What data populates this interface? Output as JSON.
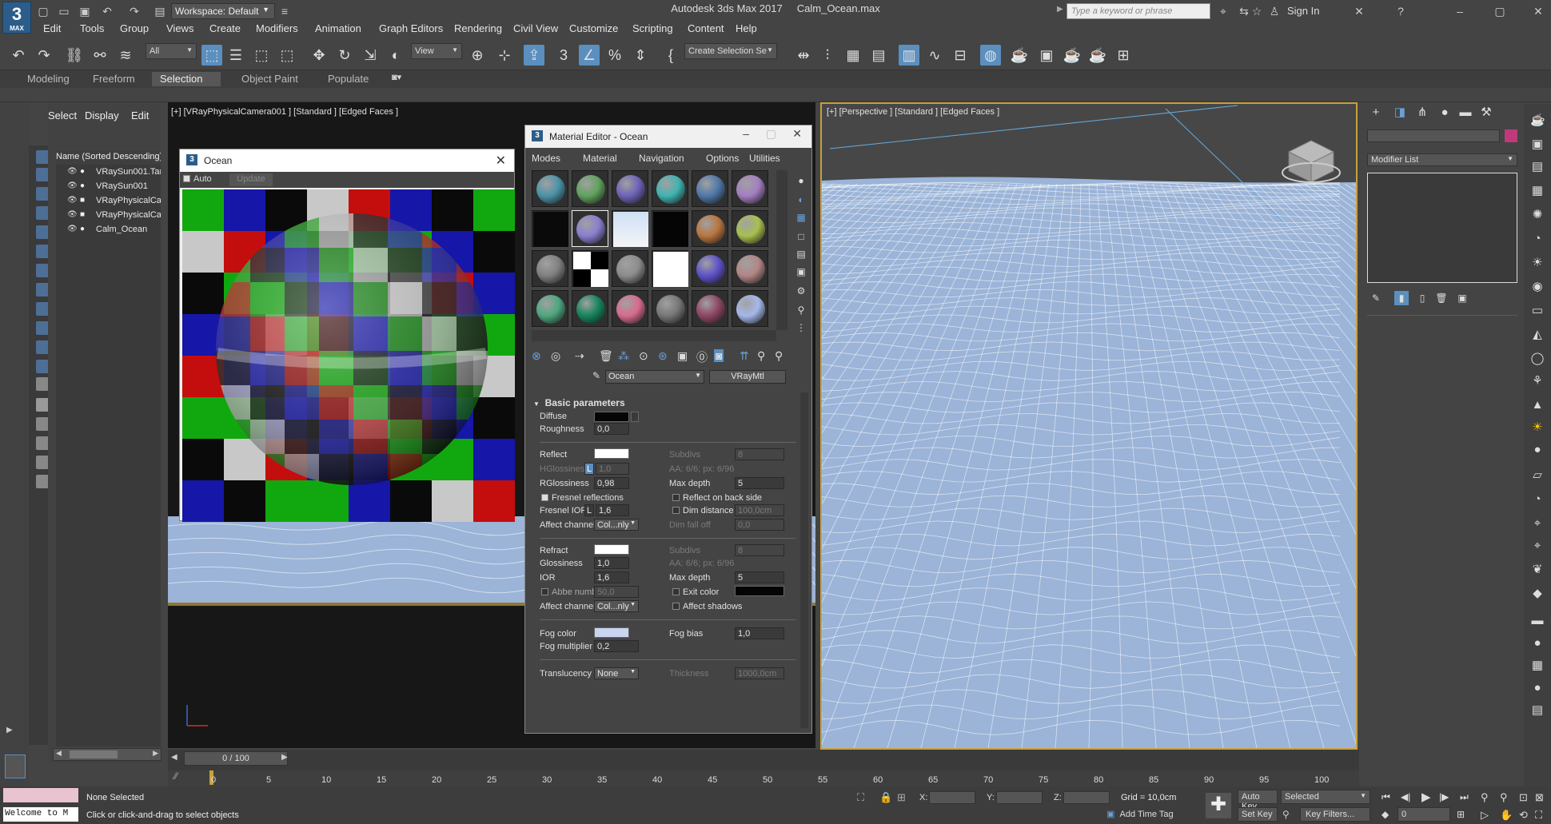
{
  "app": {
    "logo_text": "3",
    "logo_sub": "MAX",
    "title": "Autodesk 3ds Max 2017",
    "file": "Calm_Ocean.max",
    "workspace": "Workspace: Default",
    "search_placeholder": "Type a keyword or phrase",
    "sign_in": "Sign In"
  },
  "menus": [
    "Edit",
    "Tools",
    "Group",
    "Views",
    "Create",
    "Modifiers",
    "Animation",
    "Graph Editors",
    "Rendering",
    "Civil View",
    "Customize",
    "Scripting",
    "Content",
    "Help"
  ],
  "toolbar": {
    "filter": "All",
    "ref_coord": "View",
    "selection_set": "Create Selection Se"
  },
  "ribbon_tabs": [
    "Modeling",
    "Freeform",
    "Selection",
    "Object Paint",
    "Populate"
  ],
  "ribbon_active": "Selection",
  "scene_explorer": {
    "tabs": [
      "Select",
      "Display",
      "Edit"
    ],
    "header": "Name (Sorted Descending)",
    "items": [
      "VRaySun001.Tar",
      "VRaySun001",
      "VRayPhysicalCan",
      "VRayPhysicalCan",
      "Calm_Ocean"
    ]
  },
  "viewport_left": {
    "label": "[+] [VRayPhysicalCamera001 ] [Standard ] [Edged Faces ]"
  },
  "viewport_right": {
    "label": "[+] [Perspective ] [Standard ] [Edged Faces ]"
  },
  "ocean_window": {
    "title": "Ocean",
    "auto_label": "Auto",
    "update_label": "Update"
  },
  "material_editor": {
    "title": "Material Editor - Ocean",
    "menus": [
      "Modes",
      "Material",
      "Navigation",
      "Options",
      "Utilities"
    ],
    "material_name": "Ocean",
    "material_type": "VRayMtl",
    "rollout": "Basic parameters",
    "slot_colors": [
      "#4b93a8",
      "#5fa35d",
      "#6d63b8",
      "#3fb4b2",
      "#4f78a8",
      "#a47ec2",
      "#0a0a0a",
      "#8a7fd0",
      "#d8e6f5",
      "#050505",
      "#b9763f",
      "#a8c04e",
      "#808080",
      "#1a1a1a",
      "#8c8c8c",
      "#ffffff",
      "#5d52c9",
      "#b38585",
      "#4ea77f",
      "#14855b",
      "#d86b8e",
      "#777777",
      "#8e4663",
      "#a4b8ea"
    ],
    "diffuse_label": "Diffuse",
    "roughness_label": "Roughness",
    "roughness": "0,0",
    "reflect_label": "Reflect",
    "hgloss_label": "HGlossiness",
    "hgloss_lock": "L",
    "hgloss": "1,0",
    "rgloss_label": "RGlossiness",
    "rgloss": "0,98",
    "fresnel_label": "Fresnel reflections",
    "fresnel_ior_label": "Fresnel IOR",
    "fresnel_lock": "L",
    "fresnel_ior": "1,6",
    "affect_label": "Affect channels",
    "affect_value": "Col...nly",
    "subdivs_label": "Subdivs",
    "subdivs": "8",
    "aa_text": "AA: 6/6; px: 6/96",
    "maxdepth_label": "Max depth",
    "maxdepth": "5",
    "reflect_back_label": "Reflect on back side",
    "dim_distance_label": "Dim distance",
    "dim_distance": "100,0cm",
    "dim_falloff_label": "Dim fall off",
    "dim_falloff": "0,0",
    "refract_label": "Refract",
    "glossiness_label": "Glossiness",
    "glossiness": "1,0",
    "ior_label": "IOR",
    "ior": "1,6",
    "abbe_label": "Abbe number",
    "abbe": "50,0",
    "exit_color_label": "Exit color",
    "affect_shadows_label": "Affect shadows",
    "fog_color_label": "Fog color",
    "fog_bias_label": "Fog bias",
    "fog_bias": "1,0",
    "fog_mult_label": "Fog multiplier",
    "fog_mult": "0,2",
    "translucency_label": "Translucency",
    "translucency": "None",
    "thickness_label": "Thickness",
    "thickness": "1000,0cm"
  },
  "command_panel": {
    "modifier_list": "Modifier List"
  },
  "timeline": {
    "frame": "0 / 100",
    "ticks": [
      "0",
      "5",
      "10",
      "15",
      "20",
      "25",
      "30",
      "35",
      "40",
      "45",
      "50",
      "55",
      "60",
      "65",
      "70",
      "75",
      "80",
      "85",
      "90",
      "95",
      "100"
    ]
  },
  "status": {
    "welcome": "Welcome to M",
    "selection": "None Selected",
    "prompt": "Click or click-and-drag to select objects",
    "x_label": "X:",
    "y_label": "Y:",
    "z_label": "Z:",
    "grid": "Grid = 10,0cm",
    "auto_key": "Auto Key",
    "set_key": "Set Key",
    "key_mode": "Selected",
    "key_filters": "Key Filters...",
    "add_time_tag": "Add Time Tag",
    "current_frame": "0"
  }
}
